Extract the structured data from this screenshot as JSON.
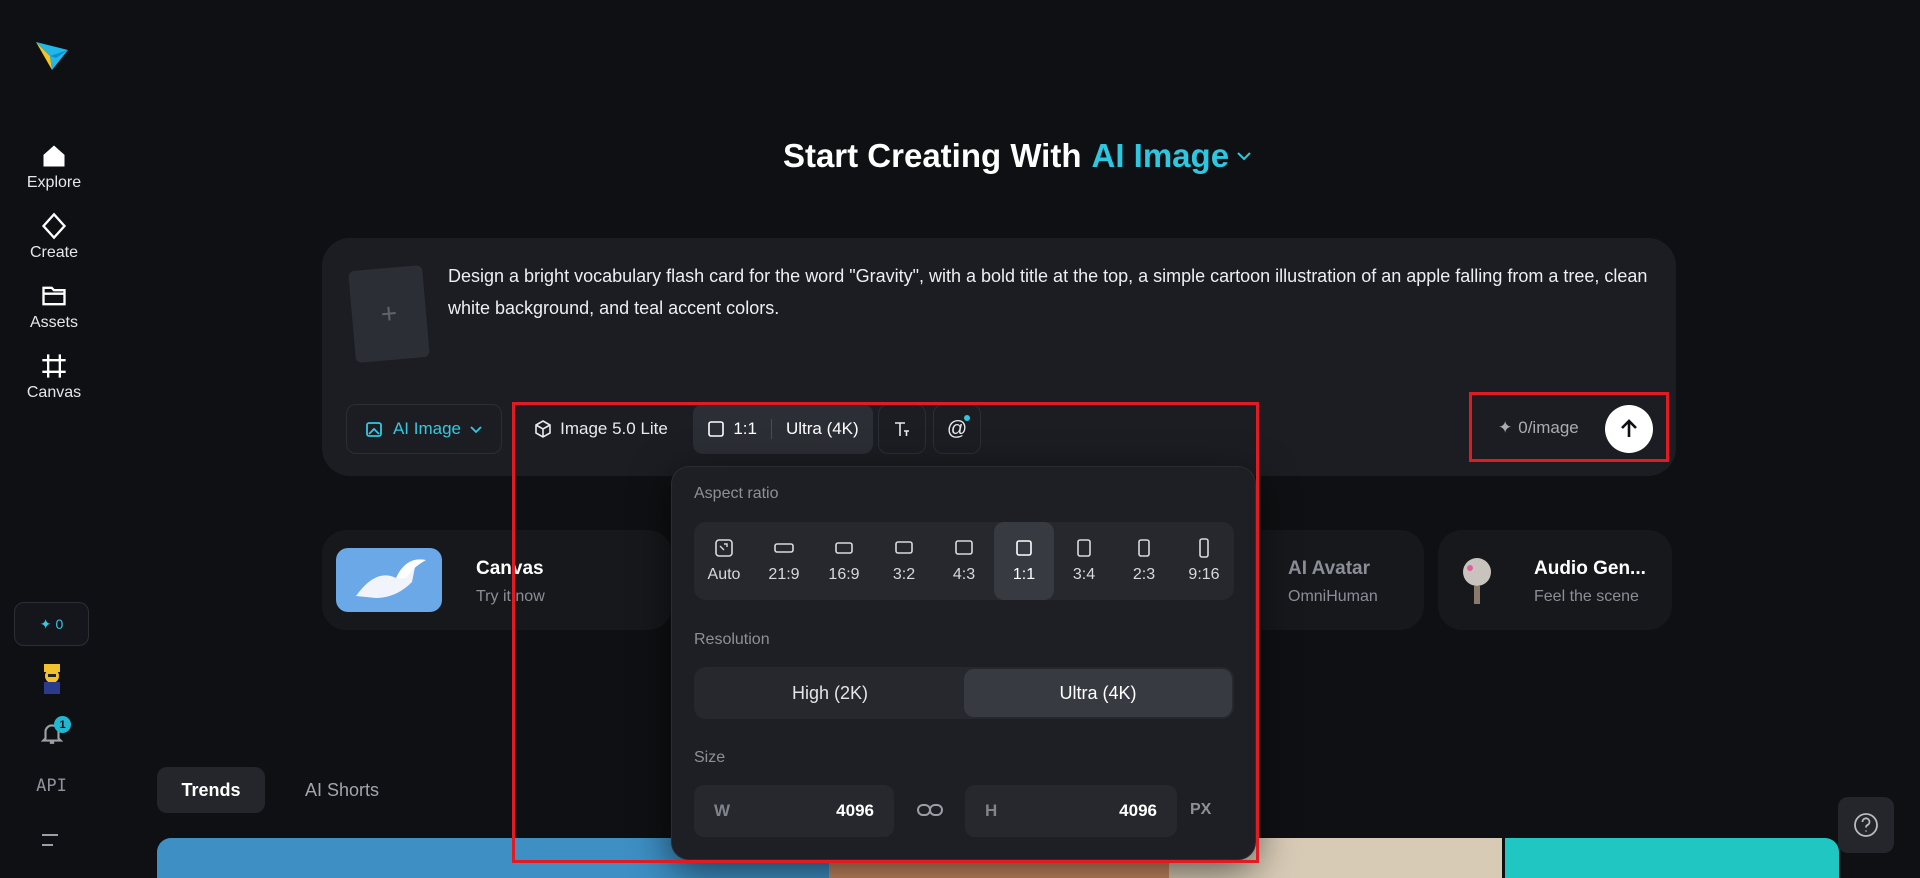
{
  "sidebar": {
    "logo_icon": "paper-plane-logo",
    "items": [
      {
        "label": "Explore",
        "icon": "home-icon"
      },
      {
        "label": "Create",
        "icon": "diamond-icon"
      },
      {
        "label": "Assets",
        "icon": "folder-icon"
      },
      {
        "label": "Canvas",
        "icon": "frame-icon"
      }
    ],
    "credits": "0",
    "notification_count": "1",
    "api_label": "API"
  },
  "header": {
    "prefix": "Start Creating With",
    "mode": "AI Image"
  },
  "prompt": {
    "text": "Design a bright vocabulary flash card for the word \"Gravity\", with a bold title at the top, a simple cartoon illustration of an apple falling from a tree, clean white background, and teal accent colors.",
    "upload_plus": "+"
  },
  "toolbar": {
    "type_label": "AI Image",
    "model_label": "Image 5.0 Lite",
    "ratio_label": "1:1",
    "resolution_label": "Ultra (4K)",
    "cost_label": "0/image"
  },
  "features": [
    {
      "title": "Canvas",
      "subtitle": "Try it now"
    },
    {
      "title": "AI Avatar",
      "subtitle": "OmniHuman"
    },
    {
      "title": "Audio Gen...",
      "subtitle": "Feel the scene"
    }
  ],
  "tabs": [
    {
      "label": "Trends",
      "active": true
    },
    {
      "label": "AI Shorts",
      "active": false
    }
  ],
  "popover": {
    "aspect_label": "Aspect ratio",
    "ratios": [
      "Auto",
      "21:9",
      "16:9",
      "3:2",
      "4:3",
      "1:1",
      "3:4",
      "2:3",
      "9:16"
    ],
    "selected_ratio": "1:1",
    "resolution_label": "Resolution",
    "resolutions": [
      "High (2K)",
      "Ultra (4K)"
    ],
    "selected_resolution": "Ultra (4K)",
    "size_label": "Size",
    "width_key": "W",
    "width_value": "4096",
    "height_key": "H",
    "height_value": "4096",
    "unit": "PX"
  },
  "colors": {
    "accent": "#2fc7e0",
    "highlight": "#e01b24",
    "background": "#0f1013"
  }
}
